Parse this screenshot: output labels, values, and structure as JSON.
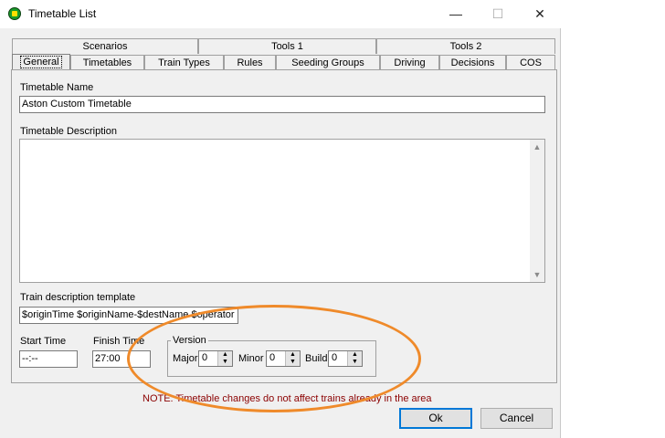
{
  "window": {
    "title": "Timetable List",
    "minimize": "—",
    "maximize": "☐",
    "close": "✕"
  },
  "tabs_back": [
    "Scenarios",
    "Tools 1",
    "Tools 2"
  ],
  "tabs_front": [
    "General",
    "Timetables",
    "Train Types",
    "Rules",
    "Seeding Groups",
    "Driving",
    "Decisions",
    "COS"
  ],
  "active_tab": "General",
  "form": {
    "name_label": "Timetable Name",
    "name_value": "Aston Custom Timetable",
    "description_label": "Timetable Description",
    "description_value": "",
    "template_label": "Train description template",
    "template_value": "$originTime $originName-$destName $operator ($",
    "start_label": "Start Time",
    "start_value": "--:--",
    "finish_label": "Finish Time",
    "finish_value": "27:00",
    "version": {
      "title": "Version",
      "major_label": "Major",
      "major_value": "0",
      "minor_label": "Minor",
      "minor_value": "0",
      "build_label": "Build",
      "build_value": "0"
    }
  },
  "note": "NOTE: Timetable changes do not affect trains already in the area",
  "buttons": {
    "ok": "Ok",
    "cancel": "Cancel"
  },
  "icons": {
    "app": "train-signal-icon",
    "up": "▲",
    "down": "▼"
  },
  "annotation_color": "#ef8a2a"
}
